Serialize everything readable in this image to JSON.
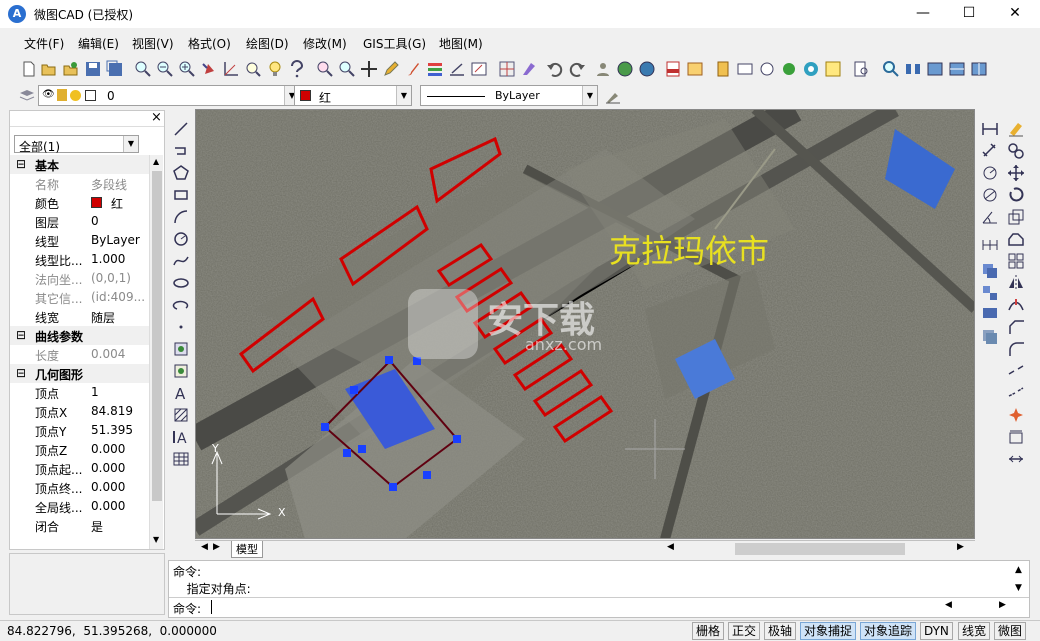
{
  "window": {
    "title": "微图CAD (已授权)",
    "app_icon": "A",
    "minimize": "—",
    "maximize": "☐",
    "close": "✕"
  },
  "menu": [
    "文件(F)",
    "编辑(E)",
    "视图(V)",
    "格式(O)",
    "绘图(D)",
    "修改(M)",
    "GIS工具(G)",
    "地图(M)"
  ],
  "layer_bar": {
    "layer": "0",
    "color_name": "红",
    "color": "#d00000",
    "linetype": "ByLayer"
  },
  "props": {
    "filter": "全部(1)",
    "close": "×",
    "sections": [
      {
        "title": "基本",
        "toggle": "⊟",
        "rows": [
          {
            "k": "名称",
            "v": "多段线",
            "dim": true
          },
          {
            "k": "颜色",
            "v": "红",
            "swatch": "#d00000"
          },
          {
            "k": "图层",
            "v": "0"
          },
          {
            "k": "线型",
            "v": "ByLayer"
          },
          {
            "k": "线型比...",
            "v": "1.000"
          },
          {
            "k": "法向坐...",
            "v": "(0,0,1)",
            "dim": true
          },
          {
            "k": "其它信...",
            "v": "(id:409...",
            "dim": true
          },
          {
            "k": "线宽",
            "v": "随层"
          }
        ]
      },
      {
        "title": "曲线参数",
        "toggle": "⊟",
        "rows": [
          {
            "k": "长度",
            "v": "0.004",
            "dim": true
          }
        ]
      },
      {
        "title": "几何图形",
        "toggle": "⊟",
        "rows": [
          {
            "k": "顶点",
            "v": "1"
          },
          {
            "k": "顶点X",
            "v": "84.819"
          },
          {
            "k": "顶点Y",
            "v": "51.395"
          },
          {
            "k": "顶点Z",
            "v": "0.000"
          },
          {
            "k": "顶点起...",
            "v": "0.000"
          },
          {
            "k": "顶点终...",
            "v": "0.000"
          },
          {
            "k": "全局线...",
            "v": "0.000"
          },
          {
            "k": "闭合",
            "v": "是"
          }
        ]
      }
    ]
  },
  "canvas": {
    "map_label": "克拉玛依市",
    "ucs_y": "Y",
    "ucs_x": "X",
    "watermark": "安下载",
    "watermark_sub": "anxz.com"
  },
  "tabs": {
    "model": "模型"
  },
  "command": {
    "lines": [
      "命令:",
      "  指定对角点:"
    ],
    "prompt": "命令:"
  },
  "status": {
    "coords": "84.822796,  51.395268,  0.000000",
    "buttons": [
      {
        "label": "栅格",
        "on": false
      },
      {
        "label": "正交",
        "on": false
      },
      {
        "label": "极轴",
        "on": false
      },
      {
        "label": "对象捕捉",
        "on": true
      },
      {
        "label": "对象追踪",
        "on": true
      },
      {
        "label": "DYN",
        "on": false
      },
      {
        "label": "线宽",
        "on": false
      },
      {
        "label": "微图",
        "on": false
      }
    ]
  }
}
